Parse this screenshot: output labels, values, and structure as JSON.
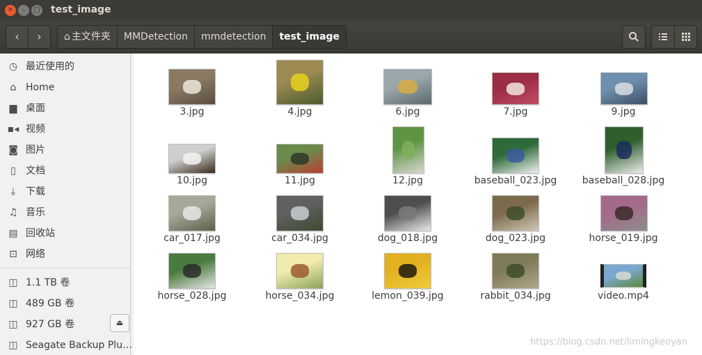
{
  "window": {
    "title": "test_image"
  },
  "breadcrumbs": [
    "主文件夹",
    "MMDetection",
    "mmdetection",
    "test_image"
  ],
  "sidebar": {
    "places": [
      {
        "label": "最近使用的",
        "icon": "clock-icon"
      },
      {
        "label": "Home",
        "icon": "home-icon"
      },
      {
        "label": "桌面",
        "icon": "folder-icon"
      },
      {
        "label": "视频",
        "icon": "video-icon"
      },
      {
        "label": "图片",
        "icon": "camera-icon"
      },
      {
        "label": "文档",
        "icon": "document-icon"
      },
      {
        "label": "下载",
        "icon": "download-icon"
      },
      {
        "label": "音乐",
        "icon": "music-icon"
      },
      {
        "label": "回收站",
        "icon": "trash-icon"
      },
      {
        "label": "网络",
        "icon": "network-icon"
      }
    ],
    "devices": [
      {
        "label": "1.1 TB 卷",
        "icon": "drive-icon"
      },
      {
        "label": "489 GB 卷",
        "icon": "drive-icon"
      },
      {
        "label": "927 GB 卷",
        "icon": "drive-icon"
      },
      {
        "label": "Seagate Backup Plu…",
        "icon": "drive-icon"
      }
    ]
  },
  "files": [
    {
      "name": "3.jpg",
      "colors": [
        "#8a7a64",
        "#ece6da",
        "#5b4f40"
      ]
    },
    {
      "name": "4.jpg",
      "colors": [
        "#9c8a52",
        "#e8d21c",
        "#4c5c2e"
      ]
    },
    {
      "name": "6.jpg",
      "colors": [
        "#9aa7ab",
        "#d8ad46",
        "#5c6b70"
      ]
    },
    {
      "name": "7.jpg",
      "colors": [
        "#9b2d45",
        "#f1e6df",
        "#c14c64"
      ]
    },
    {
      "name": "9.jpg",
      "colors": [
        "#6e8fad",
        "#d9dde2",
        "#3e4f66"
      ]
    },
    {
      "name": "10.jpg",
      "colors": [
        "#cfcfcf",
        "#f3f3f3",
        "#3a2a1a"
      ]
    },
    {
      "name": "11.jpg",
      "colors": [
        "#6b8a4c",
        "#2f3a28",
        "#b84032"
      ]
    },
    {
      "name": "12.jpg",
      "colors": [
        "#5f9444",
        "#7fb05c",
        "#d8d8d0"
      ]
    },
    {
      "name": "baseball_023.jpg",
      "colors": [
        "#2f6a3a",
        "#3a5a9c",
        "#f0f0f0"
      ]
    },
    {
      "name": "baseball_028.jpg",
      "colors": [
        "#2e5f2c",
        "#1c2c5c",
        "#ebebeb"
      ]
    },
    {
      "name": "car_017.jpg",
      "colors": [
        "#a8a89a",
        "#e6e6e6",
        "#59614b"
      ]
    },
    {
      "name": "car_034.jpg",
      "colors": [
        "#606060",
        "#c9cdd2",
        "#3c4a2e"
      ]
    },
    {
      "name": "dog_018.jpg",
      "colors": [
        "#4e4e4e",
        "#7a7a7a",
        "#e8e8e8"
      ]
    },
    {
      "name": "dog_023.jpg",
      "colors": [
        "#7c6a4d",
        "#3e4e2c",
        "#cfc7b4"
      ]
    },
    {
      "name": "horse_019.jpg",
      "colors": [
        "#a46a8a",
        "#3b2a2a",
        "#8c8c8c"
      ]
    },
    {
      "name": "horse_028.jpg",
      "colors": [
        "#4a7b3e",
        "#2b2b2b",
        "#e6e6e6"
      ]
    },
    {
      "name": "horse_034.jpg",
      "colors": [
        "#f2ebb0",
        "#9c5a32",
        "#8aa45c"
      ]
    },
    {
      "name": "lemon_039.jpg",
      "colors": [
        "#e2b020",
        "#1f1a10",
        "#f0cc3c"
      ]
    },
    {
      "name": "rabbit_034.jpg",
      "colors": [
        "#7e7a5a",
        "#3e4e2a",
        "#b0a68a"
      ]
    },
    {
      "name": "video.mp4",
      "colors": [
        "#7ba8d0",
        "#d8d8d8",
        "#5a8a3a"
      ]
    }
  ],
  "watermark": "https://blog.csdn.net/limingkeoyan"
}
